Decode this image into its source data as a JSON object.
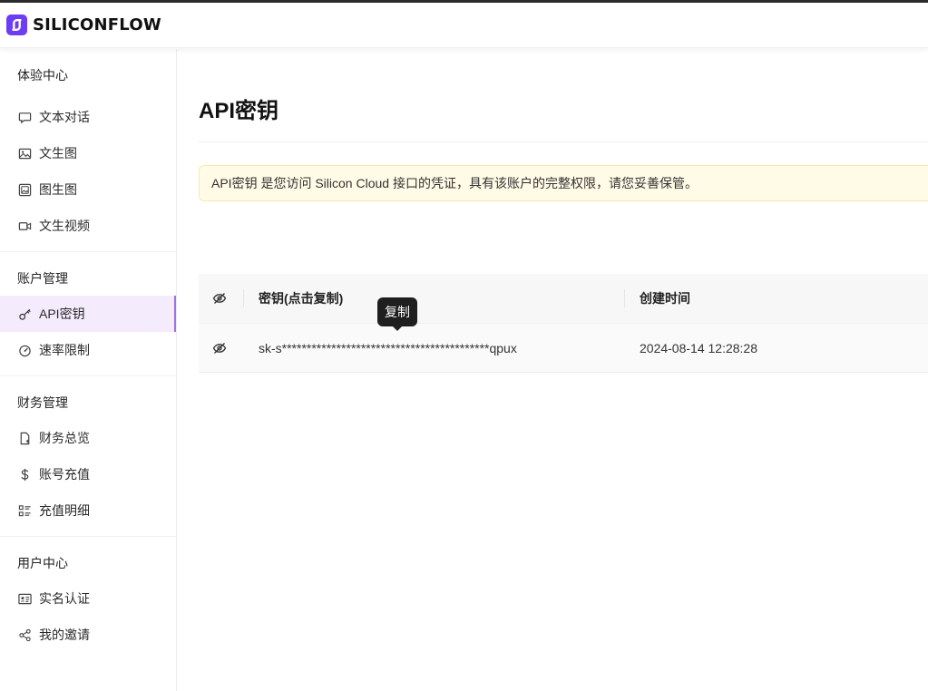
{
  "brand": {
    "name": "SILICONFLOW",
    "accent": "#6d3cf5"
  },
  "sidebar": {
    "sections": [
      {
        "title": "体验中心",
        "items": [
          {
            "label": "文本对话",
            "icon": "chat-icon"
          },
          {
            "label": "文生图",
            "icon": "image-icon"
          },
          {
            "label": "图生图",
            "icon": "image-edit-icon"
          },
          {
            "label": "文生视频",
            "icon": "video-icon"
          }
        ]
      },
      {
        "title": "账户管理",
        "items": [
          {
            "label": "API密钥",
            "icon": "key-icon",
            "active": true
          },
          {
            "label": "速率限制",
            "icon": "gauge-icon"
          }
        ]
      },
      {
        "title": "财务管理",
        "items": [
          {
            "label": "财务总览",
            "icon": "bill-icon"
          },
          {
            "label": "账号充值",
            "icon": "dollar-icon"
          },
          {
            "label": "充值明细",
            "icon": "list-icon"
          }
        ]
      },
      {
        "title": "用户中心",
        "items": [
          {
            "label": "实名认证",
            "icon": "id-card-icon"
          },
          {
            "label": "我的邀请",
            "icon": "share-icon"
          }
        ]
      }
    ]
  },
  "main": {
    "title": "API密钥",
    "notice": "API密钥 是您访问 Silicon Cloud 接口的凭证，具有该账户的完整权限，请您妥善保管。",
    "table": {
      "headers": {
        "key": "密钥(点击复制)",
        "created": "创建时间"
      },
      "rows": [
        {
          "key": "sk-s******************************************qpux",
          "created": "2024-08-14 12:28:28"
        }
      ]
    },
    "tooltip": "复制"
  },
  "colors": {
    "active_bg": "#f4ebfd",
    "active_border": "#9f70e8",
    "notice_bg": "#fffbe6",
    "notice_border": "#fbe9a6"
  }
}
